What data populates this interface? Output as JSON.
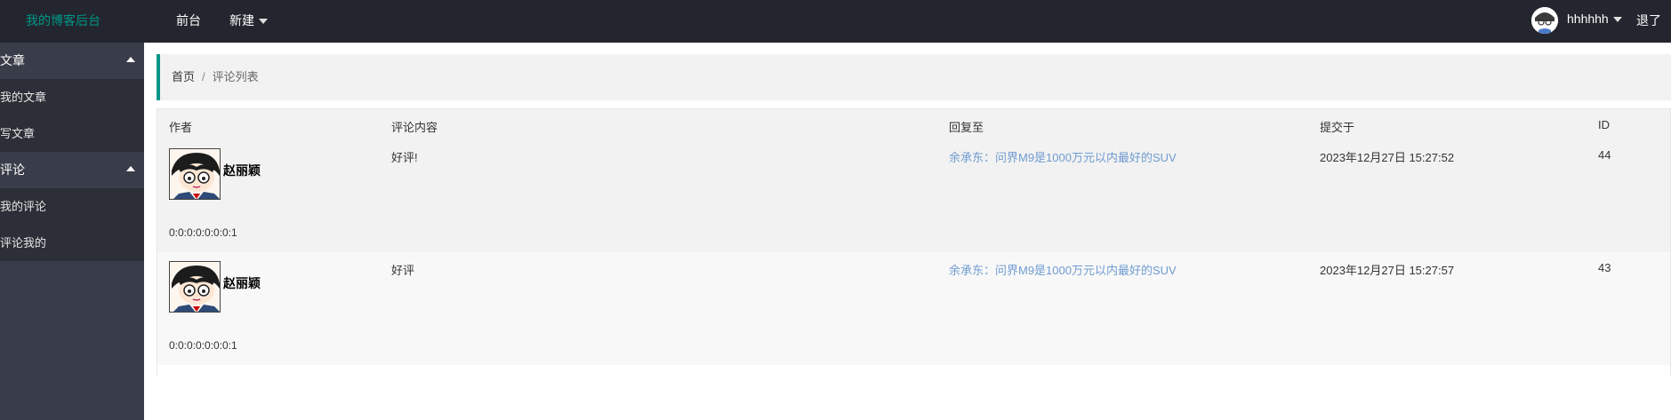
{
  "header": {
    "logo": "我的博客后台",
    "nav": {
      "front": "前台",
      "new": "新建"
    },
    "user": {
      "name": "hhhhhh",
      "logout": "退了"
    }
  },
  "sidebar": {
    "sections": [
      {
        "title": "文章",
        "items": [
          "我的文章",
          "写文章"
        ]
      },
      {
        "title": "评论",
        "items": [
          "我的评论",
          "评论我的"
        ]
      }
    ]
  },
  "breadcrumb": {
    "home": "首页",
    "separator": "/",
    "current": "评论列表"
  },
  "table": {
    "columns": [
      "作者",
      "评论内容",
      "回复至",
      "提交于",
      "ID"
    ],
    "rows": [
      {
        "author": "赵丽颖",
        "ip": "0:0:0:0:0:0:0:1",
        "content": "好评!",
        "reply_to": "余承东：问界M9是1000万元以内最好的SUV",
        "submitted": "2023年12月27日 15:27:52",
        "id": "44"
      },
      {
        "author": "赵丽颖",
        "ip": "0:0:0:0:0:0:0:1",
        "content": "好评",
        "reply_to": "余承东：问界M9是1000万元以内最好的SUV",
        "submitted": "2023年12月27日 15:27:57",
        "id": "43"
      }
    ]
  },
  "colors": {
    "topbar": "#23262e",
    "sidebar": "#393d49",
    "accent": "#009688",
    "link": "#6f9bd1"
  }
}
